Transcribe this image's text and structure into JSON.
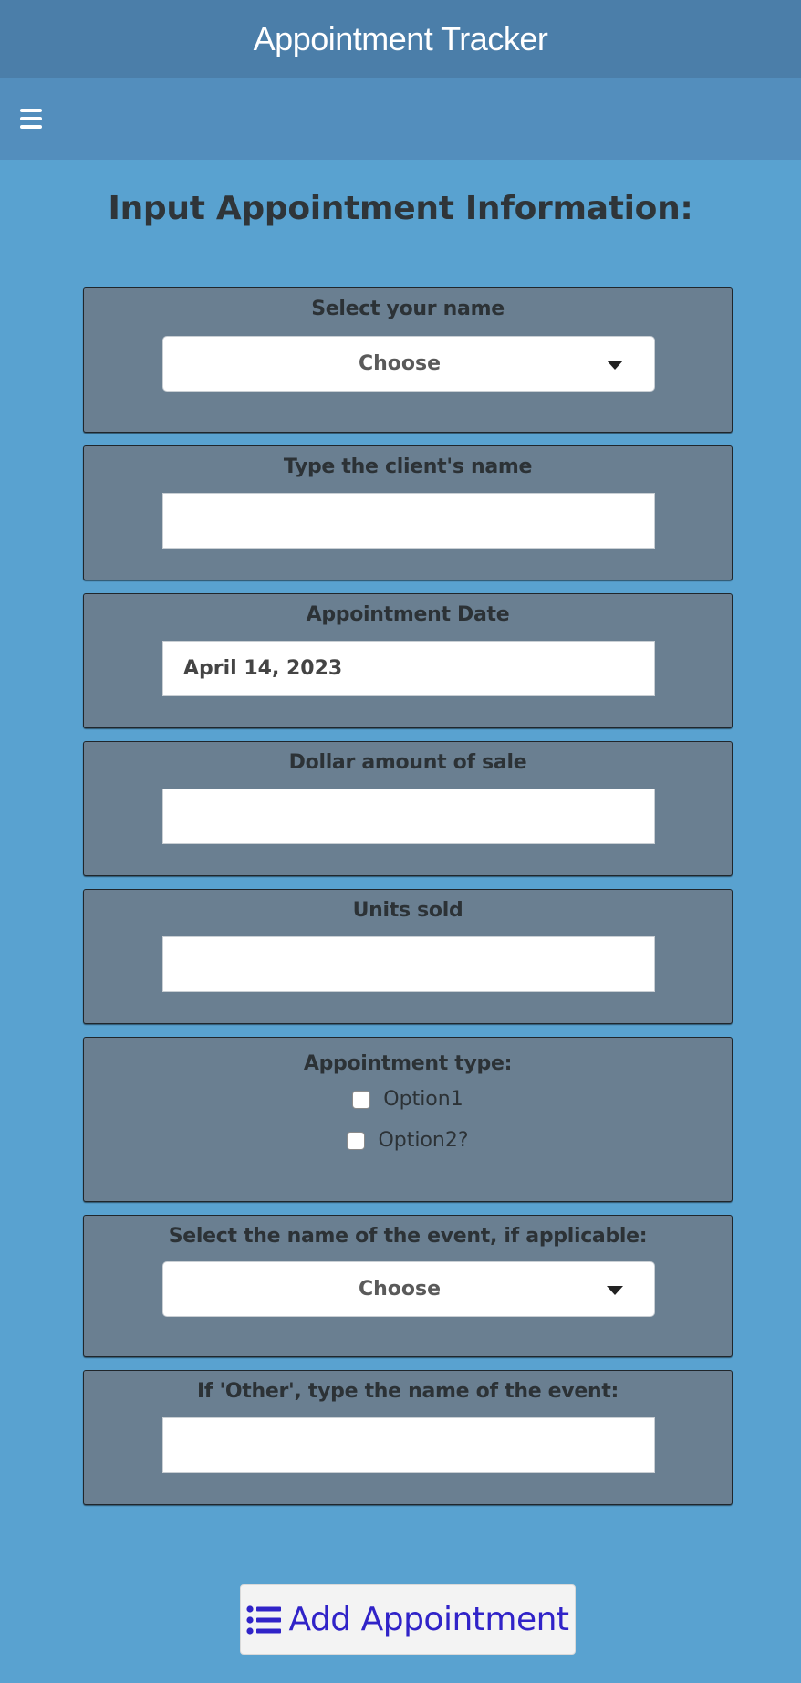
{
  "header": {
    "title": "Appointment Tracker"
  },
  "toolbar": {
    "menu_icon": "hamburger-menu-icon"
  },
  "page": {
    "title": "Input Appointment Information:"
  },
  "form": {
    "your_name": {
      "label": "Select your name",
      "value": "Choose"
    },
    "client_name": {
      "label": "Type the client's name",
      "value": ""
    },
    "appointment_date": {
      "label": "Appointment Date",
      "value": "April 14, 2023"
    },
    "dollar_amount": {
      "label": "Dollar amount of sale",
      "value": ""
    },
    "units_sold": {
      "label": "Units sold",
      "value": ""
    },
    "appointment_type": {
      "label": "Appointment type:",
      "options": [
        "Option1",
        "Option2?"
      ]
    },
    "event_name": {
      "label": "Select the name of the event, if applicable:",
      "value": "Choose"
    },
    "other_event": {
      "label": "If 'Other', type the name of the event:",
      "value": ""
    }
  },
  "actions": {
    "add_label": "Add Appointment",
    "add_icon": "list-icon"
  },
  "colors": {
    "header_bg": "#4b7ea9",
    "toolbar_bg": "#538ebd",
    "page_bg": "#59a2d0",
    "panel_bg": "#6a7f91",
    "button_text": "#3023c8"
  }
}
